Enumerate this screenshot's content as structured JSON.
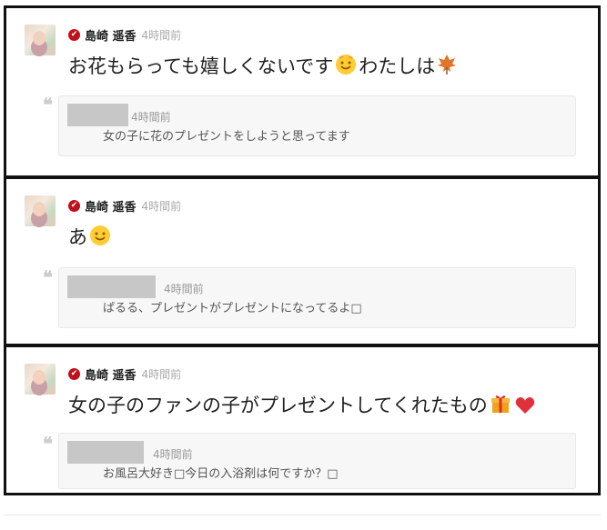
{
  "posts": [
    {
      "author": "島崎 遥香",
      "time": "4時間前",
      "text_a": "お花もらっても嬉しくないです",
      "text_b": "わたしは",
      "emojis": [
        "smiling-face-emoji",
        "maple-leaf-emoji"
      ],
      "quote": {
        "time": "4時間前",
        "text": "女の子に花のプレゼントをしようと思ってます"
      }
    },
    {
      "author": "島崎 遥香",
      "time": "4時間前",
      "text_a": "あ",
      "emojis": [
        "smiling-face-emoji"
      ],
      "quote": {
        "time": "4時間前",
        "text": "ぱるる、プレゼントがプレゼントになってるよ□"
      }
    },
    {
      "author": "島崎 遥香",
      "time": "4時間前",
      "text_a": "女の子のファンの子がプレゼントしてくれたもの",
      "emojis": [
        "gift-emoji",
        "heart-emoji"
      ],
      "quote": {
        "time": "4時間前",
        "text": "お風呂大好き□今日の入浴剤は何ですか？□"
      }
    }
  ],
  "colors": {
    "verified": "#c0101b",
    "border": "#111111",
    "quote_bg": "#f7f7f7",
    "time": "#aaaaaa"
  }
}
